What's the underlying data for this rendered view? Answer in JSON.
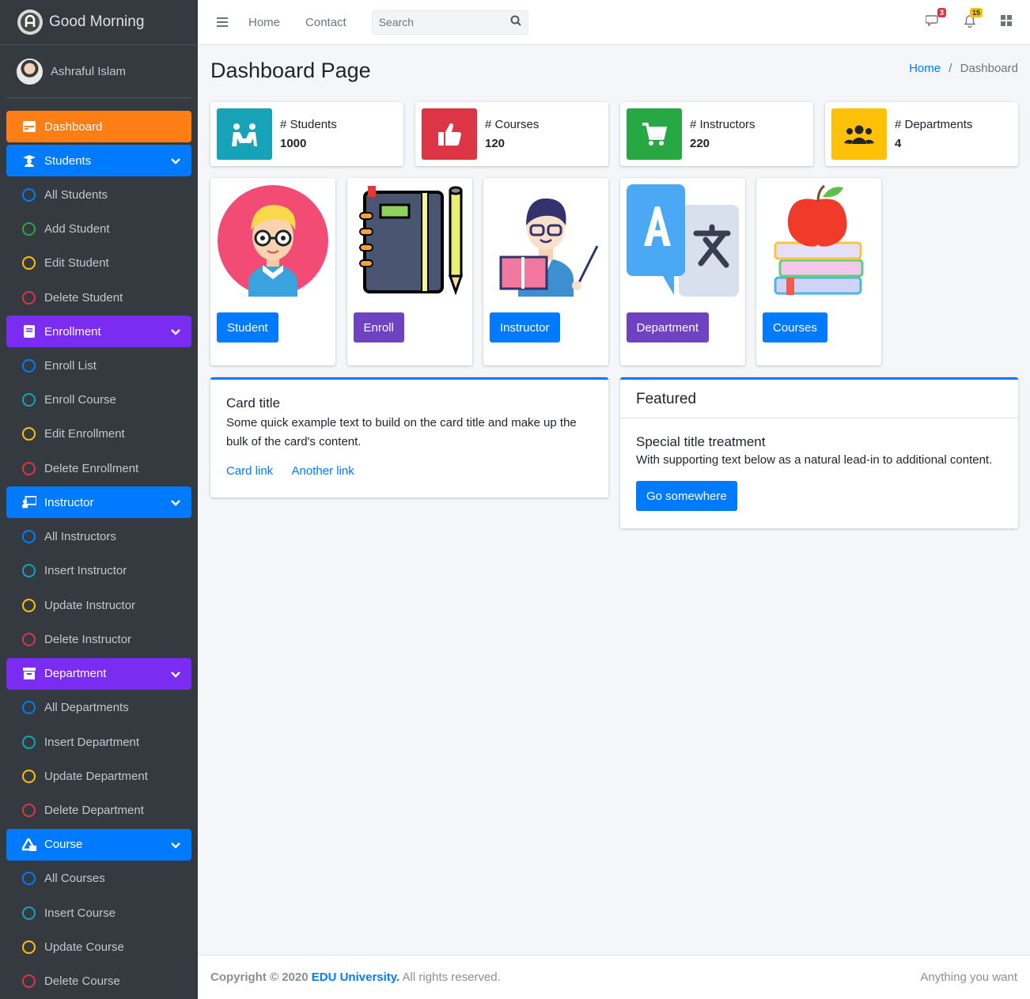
{
  "brand": {
    "title": "Good Morning",
    "logo_letter": "A"
  },
  "user": {
    "name": "Ashraful Islam"
  },
  "sidebar": {
    "sections": [
      {
        "label": "Dashboard",
        "icon": "dashboard-icon",
        "color": "#fd7e14",
        "items": []
      },
      {
        "label": "Students",
        "icon": "graduation-icon",
        "color": "#007bff",
        "items": [
          "All Students",
          "Add Student",
          "Edit Student",
          "Delete Student"
        ]
      },
      {
        "label": "Enrollment",
        "icon": "book-icon",
        "color": "#7a2cf0",
        "items": [
          "Enroll List",
          "Enroll Course",
          "Edit Enrollment",
          "Delete Enrollment"
        ]
      },
      {
        "label": "Instructor",
        "icon": "chalkboard-teacher-icon",
        "color": "#007bff",
        "items": [
          "All Instructors",
          "Insert Instructor",
          "Update Instructor",
          "Delete Instructor"
        ]
      },
      {
        "label": "Department",
        "icon": "archive-icon",
        "color": "#7a2cf0",
        "items": [
          "All Departments",
          "Insert Department",
          "Update Department",
          "Delete Department"
        ]
      },
      {
        "label": "Course",
        "icon": "shapes-icon",
        "color": "#007bff",
        "items": [
          "All Courses",
          "Insert Course",
          "Update Course",
          "Delete Course"
        ]
      }
    ],
    "circle_colors": [
      "#007bff",
      "#17a2b8",
      "#ffc107",
      "#dc3545"
    ],
    "circle_colors_students": [
      "#007bff",
      "#28a745",
      "#ffc107",
      "#dc3545"
    ]
  },
  "topbar": {
    "links": [
      "Home",
      "Contact"
    ],
    "search_placeholder": "Search",
    "messages_count": "3",
    "notifications_count": "15"
  },
  "page": {
    "title": "Dashboard Page",
    "breadcrumb": {
      "home": "Home",
      "current": "Dashboard",
      "separator": "/"
    }
  },
  "info_boxes": [
    {
      "label": "# Students",
      "value": "1000",
      "color": "#17a2b8",
      "icon": "users-icon"
    },
    {
      "label": "# Courses",
      "value": "120",
      "color": "#dc3545",
      "icon": "thumbs-up-icon"
    },
    {
      "label": "# Instructors",
      "value": "220",
      "color": "#28a745",
      "icon": "cart-icon"
    },
    {
      "label": "# Departments",
      "value": "4",
      "color": "#ffc107",
      "icon": "group-icon"
    }
  ],
  "picture_cards": [
    {
      "button": "Student",
      "style": "blue",
      "image": "student-illustration"
    },
    {
      "button": "Enroll",
      "style": "purple",
      "image": "notebook-illustration"
    },
    {
      "button": "Instructor",
      "style": "blue",
      "image": "instructor-illustration"
    },
    {
      "button": "Department",
      "style": "purple",
      "image": "translate-illustration"
    },
    {
      "button": "Courses",
      "style": "blue",
      "image": "books-apple-illustration"
    }
  ],
  "card": {
    "title": "Card title",
    "text": "Some quick example text to build on the card title and make up the bulk of the card's content.",
    "link1": "Card link",
    "link2": "Another link"
  },
  "featured": {
    "header": "Featured",
    "title": "Special title treatment",
    "text": "With supporting text below as a natural lead-in to additional content.",
    "button": "Go somewhere"
  },
  "footer": {
    "copyright": "Copyright © 2020",
    "brand": "EDU University.",
    "rights": "All rights reserved.",
    "right_text": "Anything you want"
  }
}
